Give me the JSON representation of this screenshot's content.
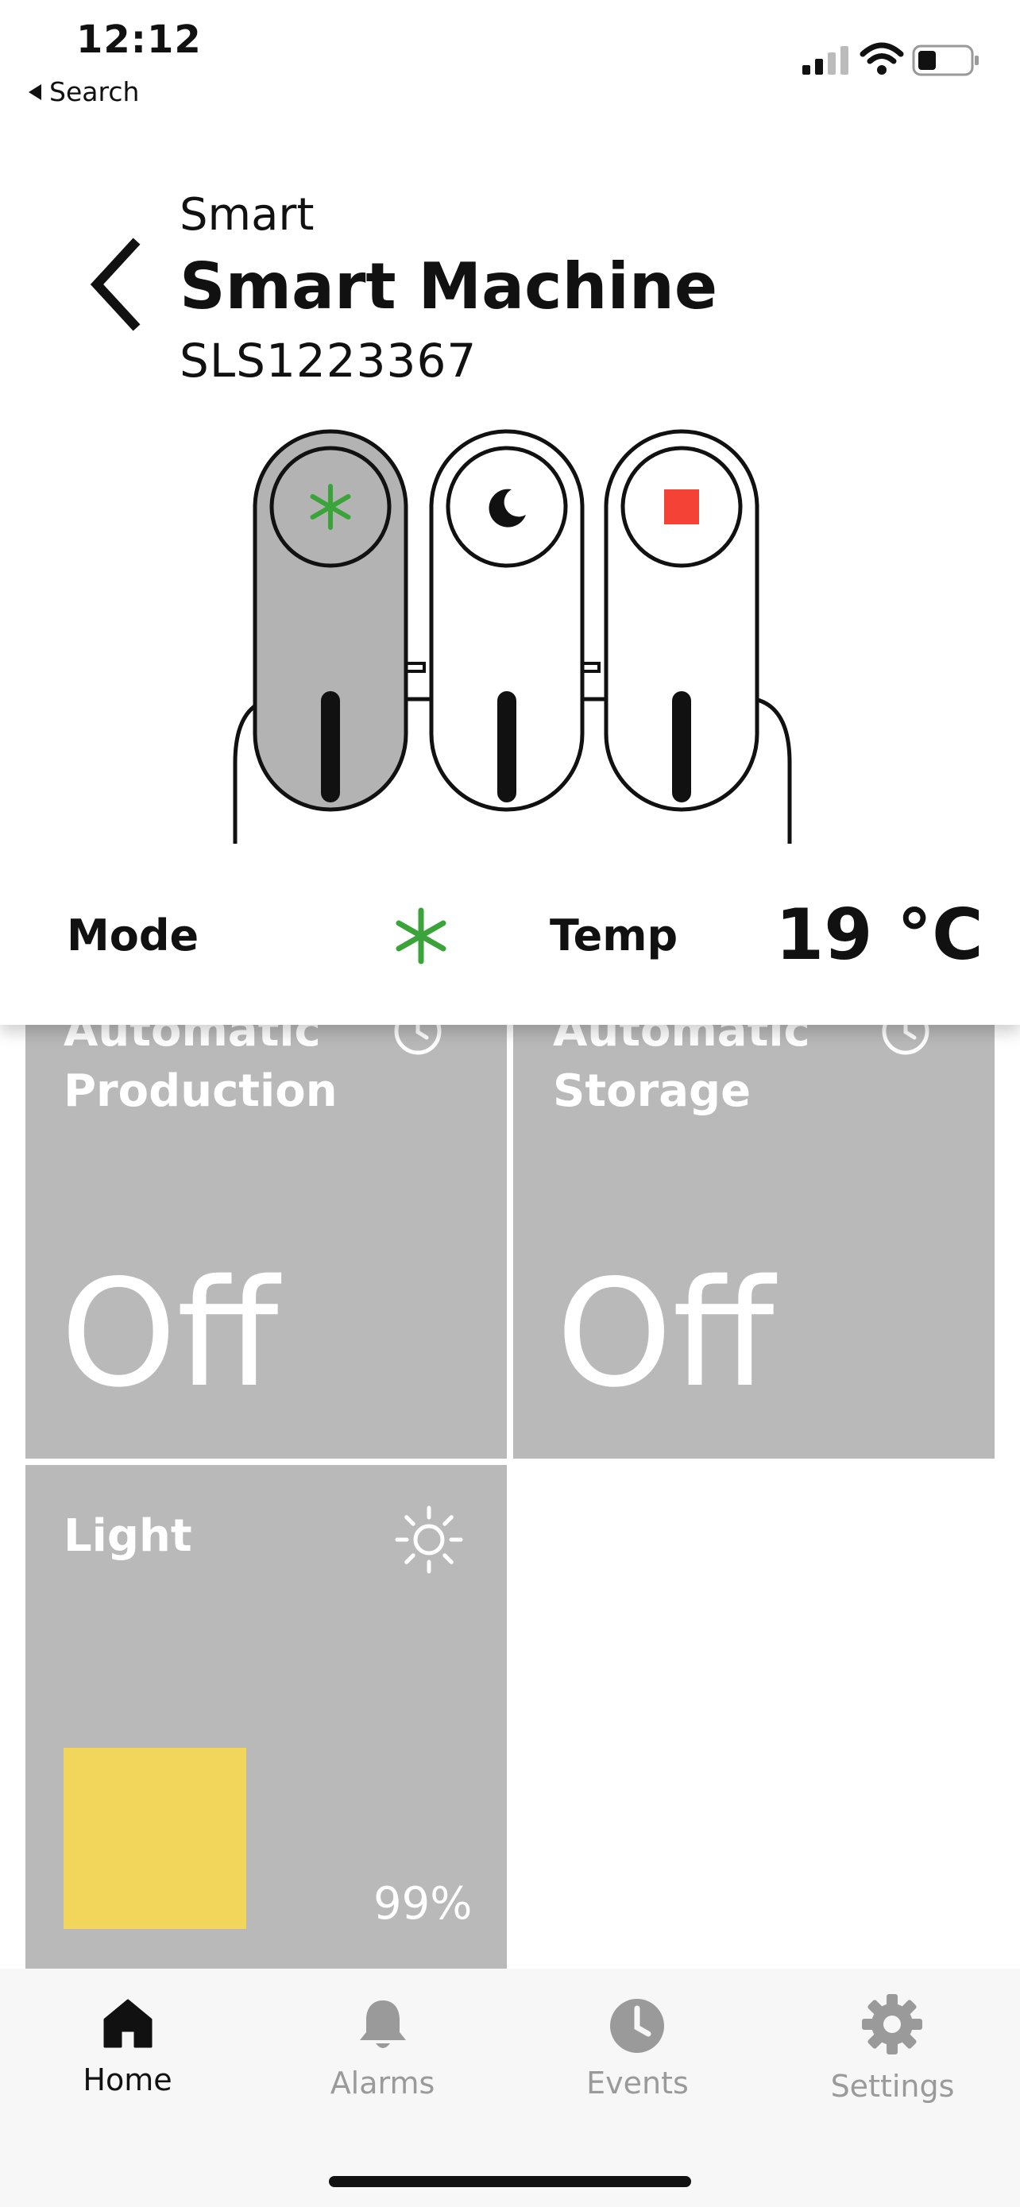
{
  "status_bar": {
    "time": "12:12",
    "back_app": "Search"
  },
  "header": {
    "subtitle": "Smart",
    "title": "Smart Machine",
    "serial": "SLS1223367"
  },
  "machine": {
    "active_mode": "production",
    "buttons": [
      "production-asterisk-icon",
      "moon-icon",
      "stop-square-icon"
    ]
  },
  "info_row": {
    "mode_label": "Mode",
    "temp_label": "Temp",
    "temp_value": "19 °C"
  },
  "tiles": [
    {
      "title_line1": "Automatic",
      "title_line2": "Production",
      "value": "Off",
      "icon": "clock-icon"
    },
    {
      "title_line1": "Automatic",
      "title_line2": "Storage",
      "value": "Off",
      "icon": "clock-icon"
    },
    {
      "title": "Light",
      "value": "99%",
      "icon": "sun-icon",
      "level": 0.99
    }
  ],
  "tabbar": {
    "items": [
      {
        "label": "Home",
        "icon": "home-icon",
        "active": true
      },
      {
        "label": "Alarms",
        "icon": "bell-icon",
        "active": false
      },
      {
        "label": "Events",
        "icon": "clock-icon",
        "active": false
      },
      {
        "label": "Settings",
        "icon": "gear-icon",
        "active": false
      }
    ]
  },
  "colors": {
    "tile_bg": "#b9b9b9",
    "accent_green": "#3aa33a",
    "stop_red": "#f44336",
    "light_yellow": "#f2d65c",
    "active_button_fill": "#b3b3b3"
  }
}
